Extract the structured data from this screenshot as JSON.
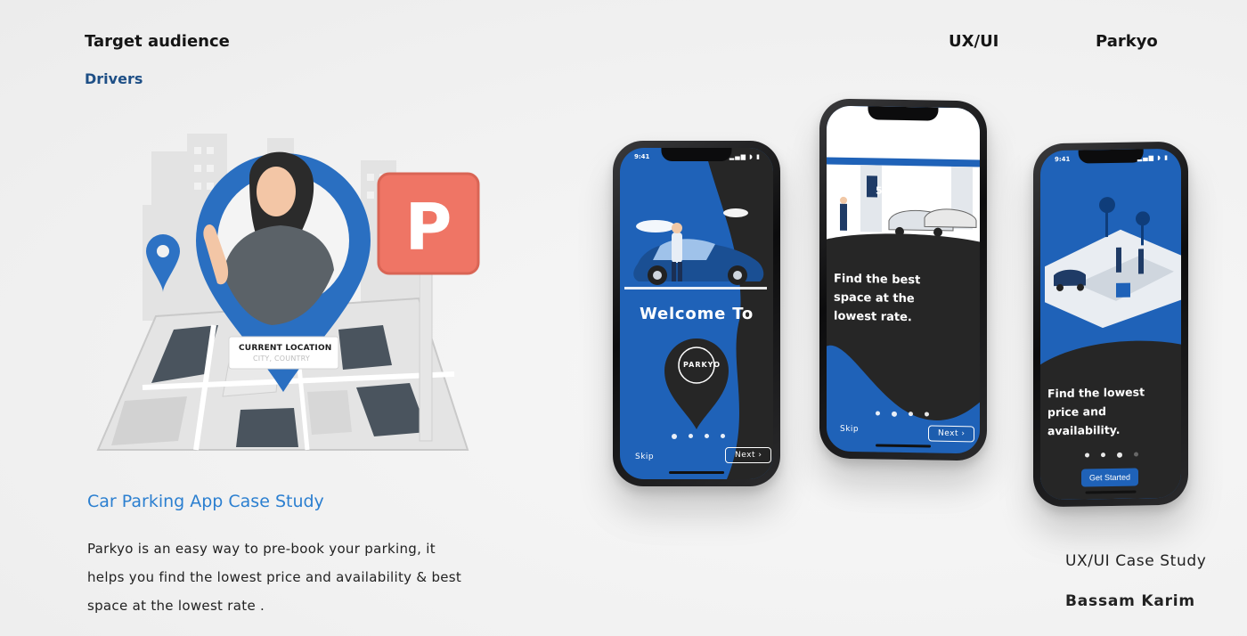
{
  "header": {
    "target_audience": "Target audience",
    "drivers": "Drivers",
    "ux_ui": "UX/UI",
    "brand": "Parkyo"
  },
  "illustration": {
    "sign_letter": "P",
    "location_label": "CURRENT LOCATION",
    "location_sub": "CITY, COUNTRY"
  },
  "case": {
    "title": "Car Parking App Case Study",
    "description": "Parkyo is an easy way to pre-book your parking, it helps you find the lowest price and availability & best space at the lowest rate ."
  },
  "footer": {
    "study": "UX/UI Case Study",
    "author": "Bassam Karim"
  },
  "phones": {
    "status_time": "9:41",
    "status_icons": "▂▄▆ ◗ ▮",
    "phone1": {
      "heading": "Welcome To",
      "logo": "PARKYO",
      "skip": "Skip",
      "next": "Next  ›"
    },
    "phone2": {
      "heading": "Find the best space at the lowest rate.",
      "sign_num": "5",
      "skip": "Skip",
      "next": "Next  ›"
    },
    "phone3": {
      "heading": "Find the lowest price and availability.",
      "cta": "Get Started"
    }
  },
  "colors": {
    "brand_blue": "#1f62b8",
    "dark": "#262626",
    "sign_red": "#ef7565",
    "accent_text": "#2b7fd0"
  }
}
